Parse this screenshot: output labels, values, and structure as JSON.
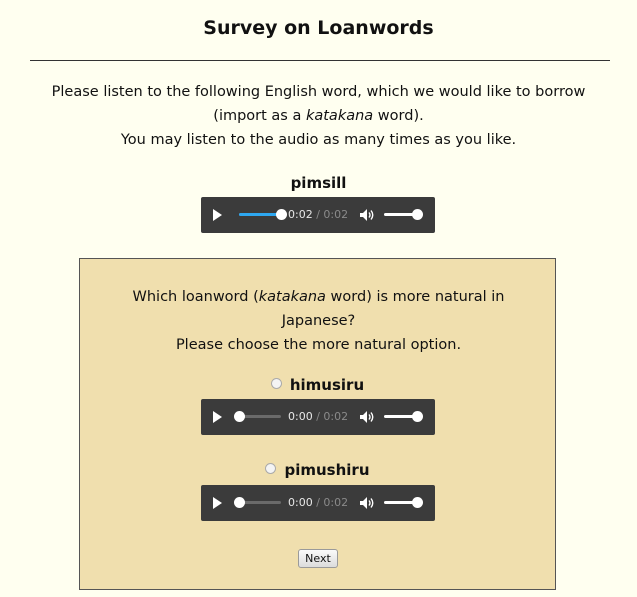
{
  "header": {
    "title": "Survey on Loanwords"
  },
  "intro": {
    "line1_pre": "Please listen to the following English word, which we would like to borrow",
    "line2_pre": "(import as a ",
    "line2_em": "katakana",
    "line2_post": " word).",
    "line3": "You may listen to the audio as many times as you like."
  },
  "target": {
    "word": "pimsill",
    "player": {
      "current_time": "0:02",
      "separator": " / ",
      "duration": "0:02",
      "progress": 1.0
    }
  },
  "question": {
    "line1_pre": "Which loanword (",
    "line1_em": "katakana",
    "line1_post": " word) is more natural in",
    "line2": "Japanese?",
    "line3": "Please choose the more natural option."
  },
  "options": [
    {
      "label": "himusiru",
      "player": {
        "current_time": "0:00",
        "separator": " / ",
        "duration": "0:02",
        "progress": 0.0
      }
    },
    {
      "label": "pimushiru",
      "player": {
        "current_time": "0:00",
        "separator": " / ",
        "duration": "0:02",
        "progress": 0.0
      }
    }
  ],
  "next_label": "Next",
  "colors": {
    "page_bg": "#fffff0",
    "panel_bg": "#f0dfae",
    "player_bg": "#3b3b3b",
    "progress_accent": "#2ea7f0"
  },
  "icons": {
    "play": "play-icon",
    "volume": "volume-icon"
  }
}
